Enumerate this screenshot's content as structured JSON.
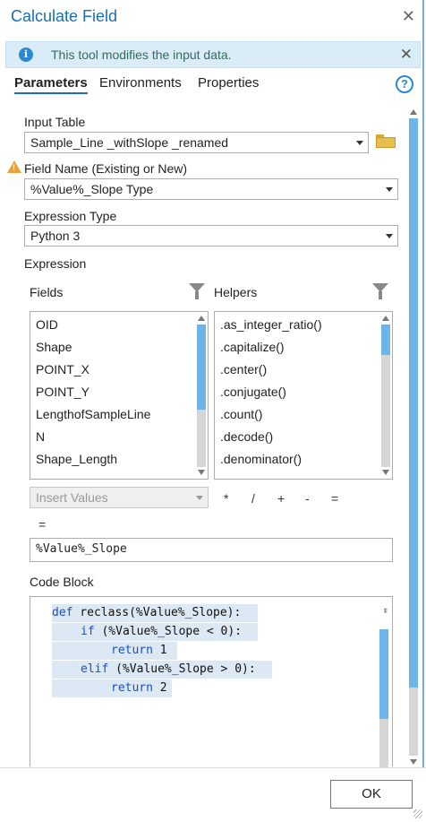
{
  "window": {
    "title": "Calculate Field",
    "close_glyph": "✕"
  },
  "info": {
    "text": "This tool modifies the input data.",
    "icon_glyph": "i",
    "close_glyph": "✕"
  },
  "tabs": [
    "Parameters",
    "Environments",
    "Properties"
  ],
  "help_glyph": "?",
  "params": {
    "input_table_label": "Input Table",
    "input_table_value": "Sample_Line _withSlope _renamed",
    "field_name_label": "Field Name (Existing or New)",
    "field_name_value": "%Value%_Slope Type",
    "expression_type_label": "Expression Type",
    "expression_type_value": "Python 3",
    "expression_label": "Expression",
    "fields_label": "Fields",
    "helpers_label": "Helpers"
  },
  "fields_list": [
    "OID",
    "Shape",
    "POINT_X",
    "POINT_Y",
    "LengthofSampleLine",
    "N",
    "Shape_Length"
  ],
  "helpers_list": [
    ".as_integer_ratio()",
    ".capitalize()",
    ".center()",
    ".conjugate()",
    ".count()",
    ".decode()",
    ".denominator()"
  ],
  "insert_values_label": "Insert Values",
  "operators": [
    "*",
    "/",
    "+",
    "-",
    "="
  ],
  "operators_second_row": [
    "="
  ],
  "expression_value": "%Value%_Slope",
  "code_block_label": "Code Block",
  "code_lines": [
    {
      "kw": "def",
      "rest": " reclass(%Value%_Slope):"
    },
    {
      "kw": "if",
      "rest": " (%Value%_Slope < 0):"
    },
    {
      "kw": "return",
      "rest": " 1"
    },
    {
      "kw": "elif",
      "rest": " (%Value%_Slope > 0):"
    },
    {
      "kw": "return",
      "rest": " 2"
    }
  ],
  "ok_label": "OK",
  "colors": {
    "accent": "#1a6fb0",
    "info_bg": "#d9ecf8",
    "scroll_thumb": "#6fb4e8",
    "warning": "#e9a33b"
  }
}
